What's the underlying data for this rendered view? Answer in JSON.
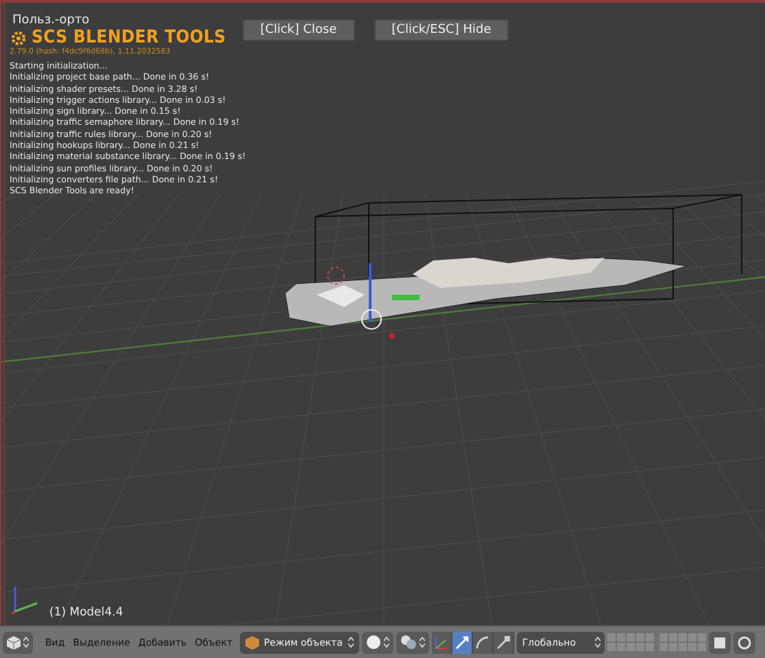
{
  "viewport": {
    "view_name": "Польз.-орто",
    "object_label": "(1) Model4.4"
  },
  "splash": {
    "title": "SCS BLENDER TOOLS",
    "version": "2.79.0 (hash: f4dc9f6d68b), 1.11.2032583",
    "buttons": [
      "[Click] Close",
      "[Click/ESC] Hide"
    ],
    "log": [
      "Starting initialization...",
      "Initializing project base path... Done in 0.36 s!",
      "Initializing shader presets... Done in 3.28 s!",
      "Initializing trigger actions library... Done in 0.03 s!",
      "Initializing sign library... Done in 0.15 s!",
      "Initializing traffic semaphore library... Done in 0.19 s!",
      "Initializing traffic rules library... Done in 0.20 s!",
      "Initializing hookups library... Done in 0.21 s!",
      "Initializing material substance library... Done in 0.19 s!",
      "Initializing sun profiles library... Done in 0.20 s!",
      "Initializing converters file path... Done in 0.21 s!",
      "SCS Blender Tools are ready!"
    ]
  },
  "header": {
    "menus": [
      "Вид",
      "Выделение",
      "Добавить",
      "Объект"
    ],
    "mode": "Режим объекта",
    "orientation": "Глобально",
    "manipulators": [
      {
        "kind": "toggle",
        "selected": false
      },
      {
        "kind": "translate",
        "selected": true
      },
      {
        "kind": "rotate",
        "selected": false
      },
      {
        "kind": "scale",
        "selected": false
      }
    ]
  }
}
